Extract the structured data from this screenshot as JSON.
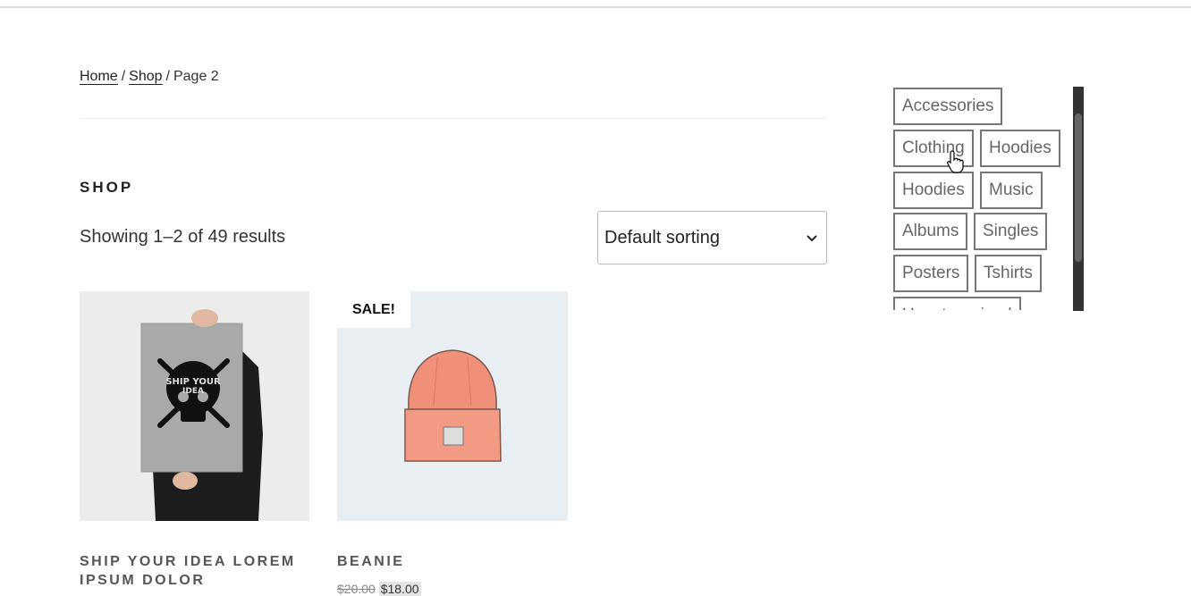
{
  "breadcrumb": {
    "home": "Home",
    "shop": "Shop",
    "current": "Page 2",
    "separator": "/"
  },
  "page_title": "SHOP",
  "result_count": "Showing 1–2 of 49 results",
  "sorting": {
    "selected": "Default sorting"
  },
  "products": [
    {
      "title": "SHIP YOUR IDEA LOREM IPSUM DOLOR",
      "image_icon": "poster-image"
    },
    {
      "title": "BEANIE",
      "badge": "SALE!",
      "price_regular": "$20.00",
      "price_sale": "$18.00",
      "image_icon": "beanie-image"
    }
  ],
  "tags": [
    "Accessories",
    "Clothing",
    "Hoodies",
    "Hoodies",
    "Music",
    "Albums",
    "Singles",
    "Posters",
    "Tshirts",
    "Uncategorized"
  ],
  "colors": {
    "accent": "#222222",
    "beanie": "#f0907a",
    "tag_border": "#777777"
  }
}
